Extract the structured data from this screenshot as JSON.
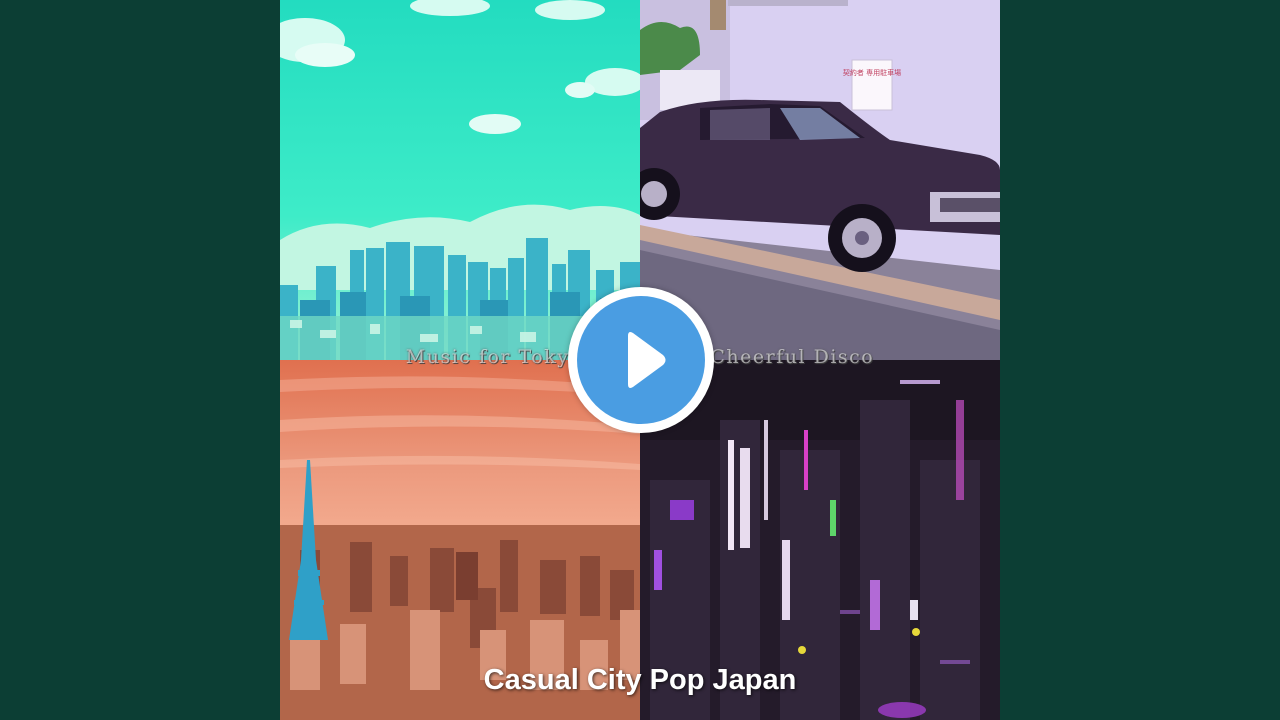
{
  "cover": {
    "subtitle_left": "Music for Tokyo",
    "subtitle_right": "Cheerful Disco",
    "title": "Casual City Pop Japan",
    "sign_text": "契約者 専用駐車場"
  },
  "controls": {
    "play_icon": "play-icon"
  },
  "colors": {
    "background": "#0c3e34",
    "play_accent": "#4a9de2",
    "sky_tl": "#2fe3c0",
    "sky_bl": "#e8836a",
    "wall_tr": "#d8cff0",
    "night_br": "#2a1f30"
  }
}
